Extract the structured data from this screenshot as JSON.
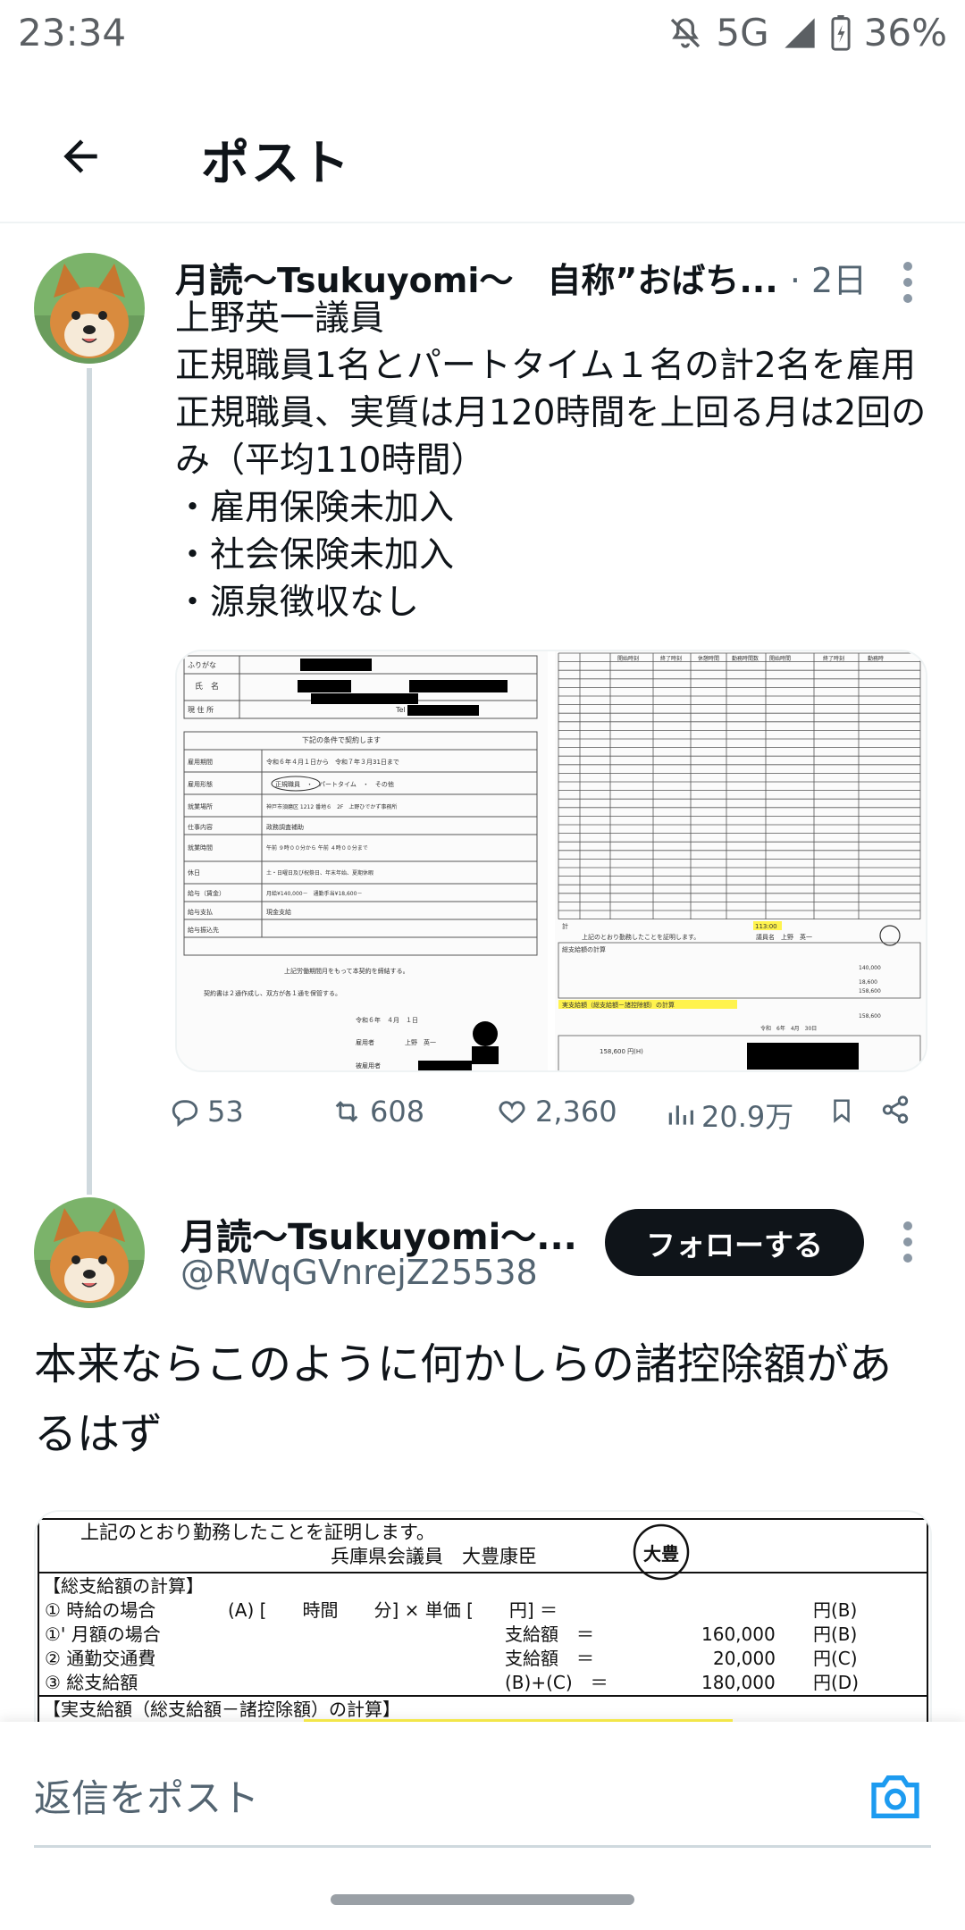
{
  "status_bar": {
    "time": "23:34",
    "network": "5G",
    "battery": "36%"
  },
  "header": {
    "title": "ポスト"
  },
  "tweet1": {
    "display_name": "月読〜Tsukuyomi〜　自称”おばち...",
    "time": "· 2日",
    "text": "上野英一議員\n正規職員1名とパートタイム１名の計2名を雇用\n正規職員、実質は月120時間を上回る月は2回のみ（平均110時間）\n・雇用保険未加入\n・社会保険未加入\n・源泉徴収なし",
    "actions": {
      "replies": "53",
      "reposts": "608",
      "likes": "2,360",
      "views": "20.9万"
    },
    "doc1": {
      "label_furigana": "ふりがな",
      "label_name": "氏　名",
      "label_address": "現 住 所",
      "tel": "Tel",
      "conditions": "下記の条件で契約します",
      "period_label": "雇用期間",
      "period_value": "令和６年４月１日から　令和７年３月31日まで",
      "type_label": "雇用形態",
      "type_value": "正規職員　・　パートタイム　・　その他",
      "place_label": "就業場所",
      "place_value": "神戸市須磨区 1212 番地６　2F　上野ひでかず事務所",
      "job_label": "仕事内容",
      "job_value": "政務調査補助",
      "hours_label": "就業時間",
      "hours_value": "午前 ９時００分から 午前 ４時００分まで",
      "holiday_label": "休日",
      "holiday_value": "土・日曜日及び祝祭日、年末年始、夏期休暇",
      "wage_label": "給与（賃金）",
      "wage_value": "月給¥140,000－　通勤手当¥18,600－",
      "pay_label": "給与支払",
      "pay_value": "現金支給",
      "transfer_label": "給与振込先",
      "agree": "上記労働期間月をもって本契約を締結する。",
      "copies": "契約書は２通作成し、双方が各１通を保管する。",
      "date": "令和６年　４月　１日",
      "employer": "雇用者",
      "employer_name": "上野　英一",
      "employee": "被雇用者"
    },
    "doc2": {
      "headers": [
        "開始時刻",
        "終了時刻",
        "休憩時間",
        "勤務時間数",
        "開始時間",
        "終了時刻",
        "勤務時"
      ],
      "certify": "上記のとおり勤務したことを証明します。",
      "member": "議員名　上野　英一",
      "total_label": "計",
      "total_hours": "113:00",
      "calc_title": "総支給額の計算",
      "salary": "140,000",
      "commute": "18,600",
      "total_pay": "158,600",
      "net_title": "実支給額（総支給額－諸控除額）の計算",
      "net_pay": "158,600",
      "yen": "158,600 円(H)",
      "date": "令和　6年　4月　30日"
    }
  },
  "tweet2": {
    "display_name": "月読〜Tsukuyomi〜...",
    "handle": "@RWqGVnrejZ25538",
    "follow_label": "フォローする",
    "text": "本来ならこのように何かしらの諸控除額があるはず",
    "doc": {
      "certify": "上記のとおり勤務したことを証明します。",
      "member": "兵庫県会議員　大豊康臣",
      "stamp": "大豊",
      "section1": "【総支給額の計算】",
      "row1_label": "① 時給の場合",
      "row1_formula": "(A) [　　時間　　分] × 単価 [　　円] ＝",
      "row1_unit": "円(B)",
      "row2_label": "①' 月額の場合",
      "row2_mid": "支給額　＝",
      "row2_value": "160,000",
      "row2_unit": "円(B)",
      "row3_label": "② 通勤交通費",
      "row3_mid": "支給額　＝",
      "row3_value": "20,000",
      "row3_unit": "円(C)",
      "row4_label": "③ 総支給額",
      "row4_mid": "(B)+(C)　＝",
      "row4_value": "180,000",
      "row4_unit": "円(D)",
      "section2": "【実支給額（総支給額－諸控除額）の計算】"
    }
  },
  "reply": {
    "placeholder": "返信をポスト"
  },
  "colors": {
    "text": "#0f1419",
    "secondary": "#536471",
    "accent": "#1d9bf0",
    "highlight": "#fff34d"
  },
  "icons": [
    "no-sound-icon",
    "signal-icon",
    "battery-icon",
    "back-arrow-icon",
    "reply-icon",
    "repost-icon",
    "like-icon",
    "views-icon",
    "bookmark-icon",
    "share-icon",
    "more-icon",
    "camera-icon"
  ]
}
